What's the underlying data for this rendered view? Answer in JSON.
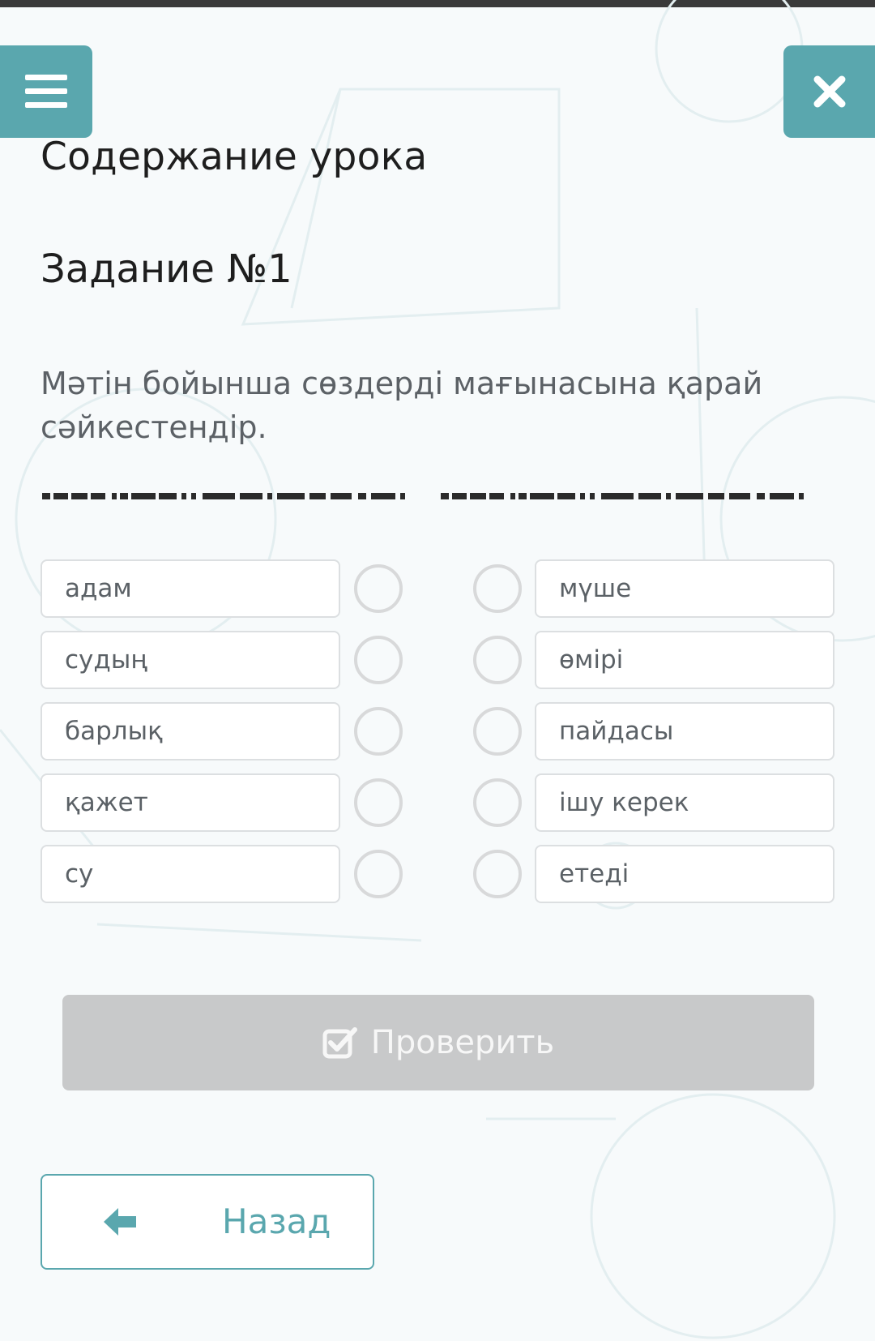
{
  "header": {
    "menu_icon": "hamburger-menu-icon",
    "close_icon": "close-x-icon",
    "lesson_title": "Содержание урока"
  },
  "task": {
    "title": "Задание №1",
    "instruction": "Мәтін бойынша сөздерді мағынасына қарай сәйкестендір."
  },
  "matching": {
    "left": [
      "адам",
      "судың",
      "барлық",
      "қажет",
      "су"
    ],
    "right": [
      "мүше",
      "өмірі",
      "пайдасы",
      "ішу керек",
      "етеді"
    ]
  },
  "actions": {
    "check_label": "Проверить",
    "check_icon": "checkbox-check-icon",
    "back_label": "Назад",
    "back_icon": "arrow-left-icon"
  },
  "colors": {
    "accent": "#5aa7ae",
    "disabled_button": "#c8c9ca",
    "text_muted": "#5b6166"
  }
}
